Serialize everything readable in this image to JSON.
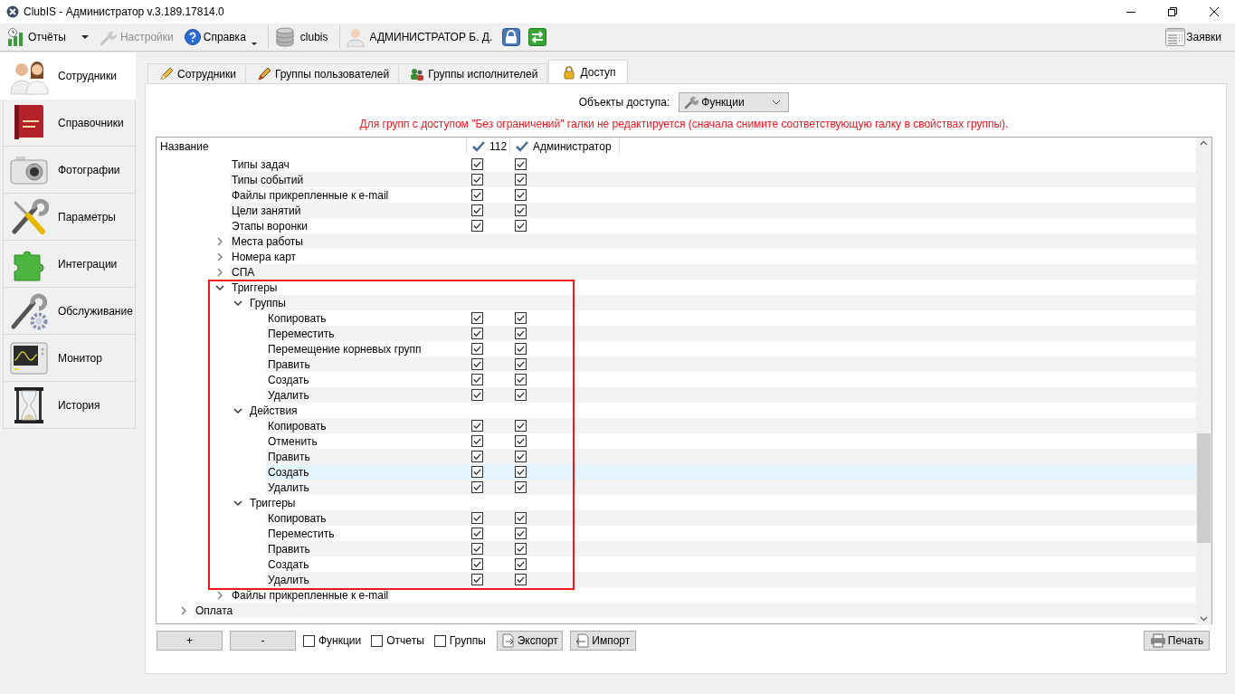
{
  "window": {
    "title": "ClubIS - Администратор v.3.189.17814.0"
  },
  "toolbar": {
    "items": [
      {
        "kind": "split-menu",
        "label": "Отчёты",
        "disabled": false
      },
      {
        "kind": "button",
        "label": "Настройки",
        "disabled": true
      },
      {
        "kind": "menu",
        "label": "Справка",
        "disabled": false
      },
      {
        "kind": "status",
        "label": "clubis",
        "disabled": false
      },
      {
        "kind": "status",
        "label": "АДМИНИСТРАТОР Б. Д.",
        "disabled": false
      },
      {
        "kind": "icon-button",
        "disabled": false
      },
      {
        "kind": "icon-button",
        "disabled": false
      }
    ],
    "right_button": {
      "label": "Заявки"
    }
  },
  "sidebar": {
    "items": [
      {
        "label": "Сотрудники",
        "selected": true
      },
      {
        "label": "Справочники",
        "selected": false
      },
      {
        "label": "Фотографии",
        "selected": false
      },
      {
        "label": "Параметры",
        "selected": false
      },
      {
        "label": "Интеграции",
        "selected": false
      },
      {
        "label": "Обслуживание",
        "selected": false
      },
      {
        "label": "Монитор",
        "selected": false
      },
      {
        "label": "История",
        "selected": false
      }
    ]
  },
  "tabs": [
    {
      "label": "Сотрудники",
      "selected": false
    },
    {
      "label": "Группы пользователей",
      "selected": false
    },
    {
      "label": "Группы исполнителей",
      "selected": false
    },
    {
      "label": "Доступ",
      "selected": true
    }
  ],
  "access_objects": {
    "label": "Объекты доступа:",
    "value": "Функции"
  },
  "notice": "Для групп с доступом \"Без ограничений\" галки не редактируется (сначала снимите соответствующую галку в свойствах группы).",
  "tree": {
    "name_column": "Название",
    "columns": [
      {
        "label": "112"
      },
      {
        "label": "Администратор"
      }
    ],
    "rows": [
      {
        "children": [
          {
            "children": [
              {
                "label": "Типы задач",
                "selected": false,
                "framed": false,
                "checks": [
                  true,
                  true
                ]
              },
              {
                "label": "Типы событий",
                "selected": false,
                "framed": false,
                "checks": [
                  true,
                  true
                ]
              },
              {
                "label": "Файлы прикрепленные к e-mail",
                "selected": false,
                "framed": false,
                "checks": [
                  true,
                  true
                ]
              },
              {
                "label": "Цели занятий",
                "selected": false,
                "framed": false,
                "checks": [
                  true,
                  true
                ]
              },
              {
                "label": "Этапы воронки",
                "selected": false,
                "framed": false,
                "checks": [
                  true,
                  true
                ]
              },
              {
                "label": "Места работы",
                "selected": false,
                "framed": false,
                "expanded": false
              },
              {
                "label": "Номера карт",
                "selected": false,
                "framed": false,
                "expanded": false
              },
              {
                "label": "СПА",
                "selected": false,
                "framed": false,
                "expanded": false
              },
              {
                "label": "Триггеры",
                "selected": false,
                "framed": true,
                "expanded": true,
                "children": [
                  {
                    "label": "Группы",
                    "selected": false,
                    "expanded": true,
                    "children": [
                      {
                        "label": "Копировать",
                        "selected": false,
                        "checks": [
                          true,
                          true
                        ]
                      },
                      {
                        "label": "Переместить",
                        "selected": false,
                        "checks": [
                          true,
                          true
                        ]
                      },
                      {
                        "label": "Перемещение корневых групп",
                        "selected": false,
                        "checks": [
                          true,
                          true
                        ]
                      },
                      {
                        "label": "Править",
                        "selected": false,
                        "checks": [
                          true,
                          true
                        ]
                      },
                      {
                        "label": "Создать",
                        "selected": false,
                        "checks": [
                          true,
                          true
                        ]
                      },
                      {
                        "label": "Удалить",
                        "selected": false,
                        "checks": [
                          true,
                          true
                        ]
                      }
                    ]
                  },
                  {
                    "label": "Действия",
                    "selected": false,
                    "expanded": true,
                    "children": [
                      {
                        "label": "Копировать",
                        "selected": false,
                        "checks": [
                          true,
                          true
                        ]
                      },
                      {
                        "label": "Отменить",
                        "selected": false,
                        "checks": [
                          true,
                          true
                        ]
                      },
                      {
                        "label": "Править",
                        "selected": false,
                        "checks": [
                          true,
                          true
                        ]
                      },
                      {
                        "label": "Создать",
                        "selected": true,
                        "checks": [
                          true,
                          true
                        ]
                      },
                      {
                        "label": "Удалить",
                        "selected": false,
                        "checks": [
                          true,
                          true
                        ]
                      }
                    ]
                  },
                  {
                    "label": "Триггеры",
                    "selected": false,
                    "expanded": true,
                    "children": [
                      {
                        "label": "Копировать",
                        "selected": false,
                        "checks": [
                          true,
                          true
                        ]
                      },
                      {
                        "label": "Переместить",
                        "selected": false,
                        "checks": [
                          true,
                          true
                        ]
                      },
                      {
                        "label": "Править",
                        "selected": false,
                        "checks": [
                          true,
                          true
                        ]
                      },
                      {
                        "label": "Создать",
                        "selected": false,
                        "checks": [
                          true,
                          true
                        ]
                      },
                      {
                        "label": "Удалить",
                        "selected": false,
                        "checks": [
                          true,
                          true
                        ]
                      }
                    ]
                  }
                ]
              },
              {
                "label": "Файлы прикрепленные к e-mail",
                "selected": false,
                "framed": false,
                "expanded": false
              }
            ]
          }
        ]
      },
      {
        "label": "Оплата",
        "selected": false,
        "expanded": false
      }
    ]
  },
  "bottom_bar": {
    "add_button": "+",
    "remove_button": "-",
    "filters": [
      {
        "label": "Функции",
        "checked": false
      },
      {
        "label": "Отчеты",
        "checked": false
      },
      {
        "label": "Группы",
        "checked": false
      }
    ],
    "export_button": "Экспорт",
    "import_button": "Импорт",
    "print_button": "Печать"
  }
}
